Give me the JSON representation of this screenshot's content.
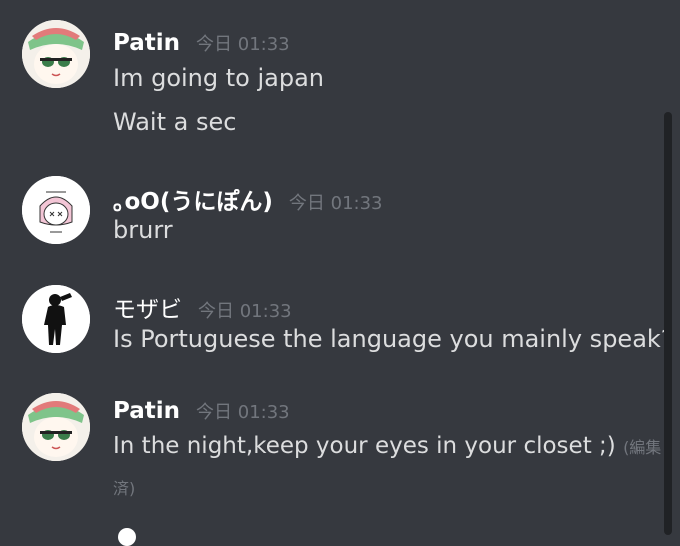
{
  "messages": [
    {
      "username": "Patin",
      "timestamp": "今日 01:33",
      "avatar": "anime-girl-green-hat-avatar",
      "lines": [
        "Im going to japan",
        "Wait a sec"
      ]
    },
    {
      "username": "｡oO(うにぽん)",
      "timestamp": "今日 01:33",
      "avatar": "pink-hair-sketch-avatar",
      "lines": [
        "brurr"
      ]
    },
    {
      "username": "モザビ",
      "timestamp": "今日 01:33",
      "avatar": "black-silhouette-avatar",
      "lines": [
        "Is Portuguese the language you mainly speak?"
      ]
    },
    {
      "username": "Patin",
      "timestamp": "今日 01:33",
      "avatar": "anime-girl-green-hat-avatar",
      "lines": [
        "In the night,keep your eyes in your closet ;)"
      ],
      "edited_label_part1": "(編集",
      "edited_label_part2": "済)"
    }
  ],
  "colors": {
    "background": "#36393f",
    "username": "#ffffff",
    "message_text": "#dcddde",
    "timestamp": "#72767d",
    "scrollbar": "#202225"
  }
}
